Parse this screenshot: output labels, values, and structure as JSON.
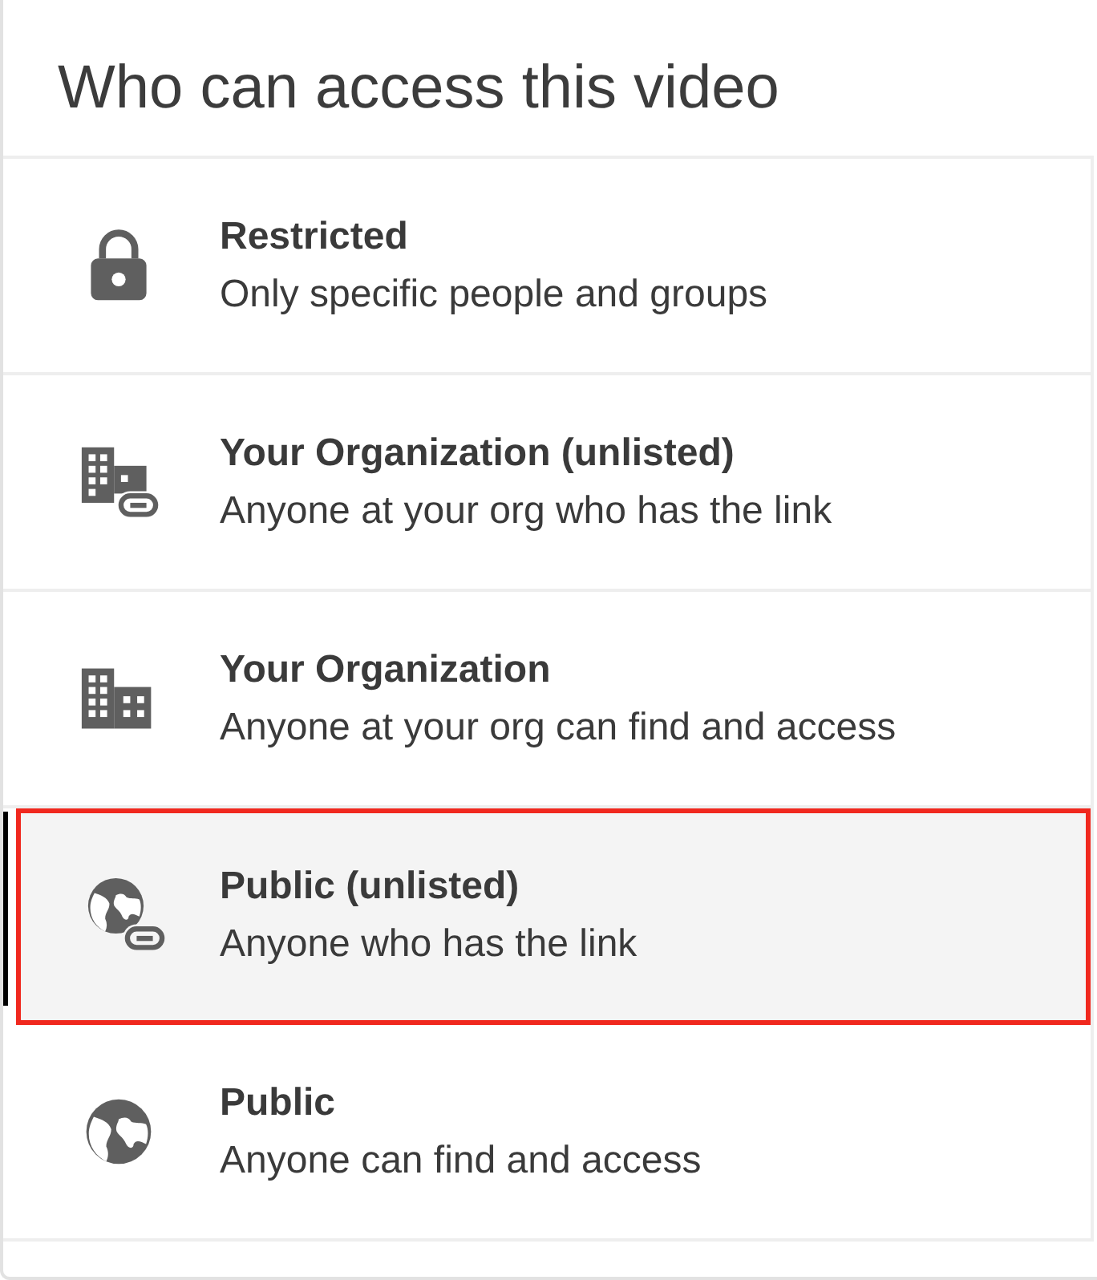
{
  "title": "Who can access this video",
  "options": [
    {
      "kind": "lock",
      "label": "Restricted",
      "description": "Only specific people and groups",
      "selected": false
    },
    {
      "kind": "building-link",
      "label": "Your Organization (unlisted)",
      "description": "Anyone at your org who has the link",
      "selected": false
    },
    {
      "kind": "building",
      "label": "Your Organization",
      "description": "Anyone at your org can find and access",
      "selected": false
    },
    {
      "kind": "globe-link",
      "label": "Public (unlisted)",
      "description": "Anyone who has the link",
      "selected": true
    },
    {
      "kind": "globe",
      "label": "Public",
      "description": "Anyone can find and access",
      "selected": false
    }
  ]
}
